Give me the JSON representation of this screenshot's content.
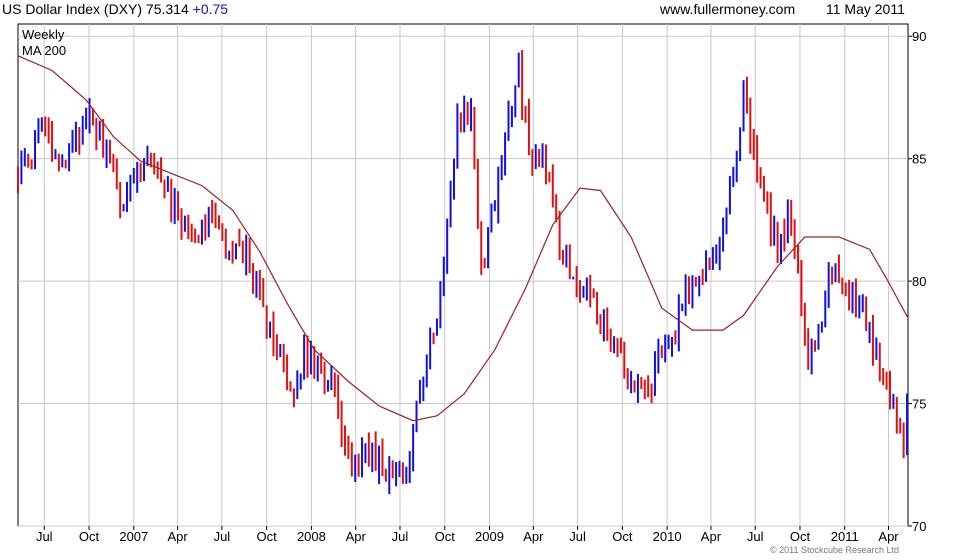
{
  "header": {
    "title": "US Dollar Index (DXY) 75.314",
    "change": "+0.75",
    "site": "www.fullermoney.com",
    "date": "11 May 2011"
  },
  "legend": {
    "weekly": "Weekly",
    "ma": "MA 200"
  },
  "copyright": "© 2011 Stockcube Research Ltd",
  "colors": {
    "up": "#1010e0",
    "down": "#e01010",
    "ma": "#a52020",
    "grid": "#c8c8c8",
    "axis": "#000000"
  },
  "chart_data": {
    "type": "line",
    "title": "US Dollar Index (DXY) 75.314",
    "frequency": "weekly",
    "y_scale": "linear",
    "ylim": [
      70,
      90.5
    ],
    "y_ticks": [
      70,
      75,
      80,
      85,
      90
    ],
    "x_tick_labels": [
      "Jul",
      "Oct",
      "2007",
      "Apr",
      "Jul",
      "Oct",
      "2008",
      "Apr",
      "Jul",
      "Oct",
      "2009",
      "Apr",
      "Jul",
      "Oct",
      "2010",
      "Apr",
      "Jul",
      "Oct",
      "2011",
      "Apr"
    ],
    "x_tick_dates": [
      "2006-07-01",
      "2006-10-01",
      "2007-01-01",
      "2007-04-01",
      "2007-07-01",
      "2007-10-01",
      "2008-01-01",
      "2008-04-01",
      "2008-07-01",
      "2008-10-01",
      "2009-01-01",
      "2009-04-01",
      "2009-07-01",
      "2009-10-01",
      "2010-01-01",
      "2010-04-01",
      "2010-07-01",
      "2010-10-01",
      "2011-01-01",
      "2011-04-01"
    ],
    "xlim": [
      "2006-05-08",
      "2011-05-11"
    ],
    "grid": true,
    "legend": [
      "Weekly",
      "MA 200"
    ],
    "legend_position": "top-left",
    "series": [
      {
        "name": "Weekly",
        "kind": "close-anchors",
        "points": [
          [
            "2006-05-08",
            84.3
          ],
          [
            "2006-06-05",
            85.2
          ],
          [
            "2006-06-26",
            86.5
          ],
          [
            "2006-07-17",
            85.6
          ],
          [
            "2006-08-14",
            85.1
          ],
          [
            "2006-09-11",
            86.2
          ],
          [
            "2006-10-09",
            86.8
          ],
          [
            "2006-10-23",
            86.0
          ],
          [
            "2006-11-20",
            84.2
          ],
          [
            "2006-12-04",
            82.8
          ],
          [
            "2007-01-08",
            84.8
          ],
          [
            "2007-02-05",
            85.1
          ],
          [
            "2007-03-05",
            83.8
          ],
          [
            "2007-04-02",
            82.7
          ],
          [
            "2007-04-23",
            81.7
          ],
          [
            "2007-06-11",
            82.7
          ],
          [
            "2007-07-09",
            80.8
          ],
          [
            "2007-08-20",
            81.2
          ],
          [
            "2007-09-24",
            78.5
          ],
          [
            "2007-11-05",
            76.4
          ],
          [
            "2007-11-26",
            75.2
          ],
          [
            "2007-12-17",
            77.3
          ],
          [
            "2008-01-14",
            76.2
          ],
          [
            "2008-02-11",
            75.9
          ],
          [
            "2008-03-10",
            72.9
          ],
          [
            "2008-04-07",
            72.3
          ],
          [
            "2008-04-21",
            73.4
          ],
          [
            "2008-05-26",
            72.3
          ],
          [
            "2008-06-23",
            72.4
          ],
          [
            "2008-07-14",
            72.0
          ],
          [
            "2008-08-04",
            74.8
          ],
          [
            "2008-08-25",
            77.2
          ],
          [
            "2008-09-15",
            78.1
          ],
          [
            "2008-10-06",
            81.9
          ],
          [
            "2008-10-27",
            86.2
          ],
          [
            "2008-11-24",
            87.3
          ],
          [
            "2008-12-15",
            80.2
          ],
          [
            "2008-12-29",
            81.8
          ],
          [
            "2009-01-19",
            84.2
          ],
          [
            "2009-02-09",
            86.6
          ],
          [
            "2009-03-02",
            88.9
          ],
          [
            "2009-03-23",
            85.2
          ],
          [
            "2009-04-13",
            84.8
          ],
          [
            "2009-05-04",
            84.6
          ],
          [
            "2009-05-25",
            81.2
          ],
          [
            "2009-06-22",
            80.5
          ],
          [
            "2009-07-27",
            79.2
          ],
          [
            "2009-08-24",
            78.3
          ],
          [
            "2009-10-05",
            76.4
          ],
          [
            "2009-11-23",
            75.2
          ],
          [
            "2009-12-14",
            76.8
          ],
          [
            "2010-01-11",
            77.5
          ],
          [
            "2010-02-08",
            79.5
          ],
          [
            "2010-03-08",
            80.3
          ],
          [
            "2010-04-19",
            81.2
          ],
          [
            "2010-05-10",
            83.6
          ],
          [
            "2010-06-07",
            87.6
          ],
          [
            "2010-06-28",
            85.3
          ],
          [
            "2010-07-26",
            82.6
          ],
          [
            "2010-08-16",
            81.2
          ],
          [
            "2010-09-06",
            82.8
          ],
          [
            "2010-09-27",
            80.3
          ],
          [
            "2010-10-18",
            77.2
          ],
          [
            "2010-11-08",
            77.6
          ],
          [
            "2010-11-29",
            80.8
          ],
          [
            "2010-12-20",
            80.1
          ],
          [
            "2011-01-10",
            79.4
          ],
          [
            "2011-02-07",
            78.8
          ],
          [
            "2011-03-07",
            77.2
          ],
          [
            "2011-04-04",
            75.5
          ],
          [
            "2011-04-25",
            73.8
          ],
          [
            "2011-05-02",
            73.2
          ],
          [
            "2011-05-11",
            75.3
          ]
        ]
      },
      {
        "name": "MA 200",
        "kind": "line",
        "points": [
          [
            "2006-05-08",
            89.2
          ],
          [
            "2006-07-17",
            88.6
          ],
          [
            "2006-09-25",
            87.4
          ],
          [
            "2006-11-20",
            85.9
          ],
          [
            "2007-01-15",
            84.9
          ],
          [
            "2007-03-19",
            84.4
          ],
          [
            "2007-05-21",
            83.9
          ],
          [
            "2007-07-23",
            82.9
          ],
          [
            "2007-09-17",
            81.2
          ],
          [
            "2007-11-12",
            79.1
          ],
          [
            "2008-01-07",
            77.2
          ],
          [
            "2008-03-17",
            75.9
          ],
          [
            "2008-05-19",
            74.9
          ],
          [
            "2008-07-28",
            74.3
          ],
          [
            "2008-09-15",
            74.5
          ],
          [
            "2008-11-10",
            75.4
          ],
          [
            "2009-01-12",
            77.2
          ],
          [
            "2009-03-16",
            79.7
          ],
          [
            "2009-05-11",
            82.3
          ],
          [
            "2009-07-06",
            83.8
          ],
          [
            "2009-08-17",
            83.7
          ],
          [
            "2009-10-19",
            81.8
          ],
          [
            "2009-12-21",
            78.9
          ],
          [
            "2010-02-22",
            78.0
          ],
          [
            "2010-04-26",
            78.0
          ],
          [
            "2010-06-07",
            78.6
          ],
          [
            "2010-08-16",
            80.6
          ],
          [
            "2010-10-11",
            81.8
          ],
          [
            "2010-12-20",
            81.8
          ],
          [
            "2011-02-21",
            81.3
          ],
          [
            "2011-03-28",
            80.1
          ],
          [
            "2011-05-11",
            78.5
          ]
        ]
      }
    ]
  }
}
